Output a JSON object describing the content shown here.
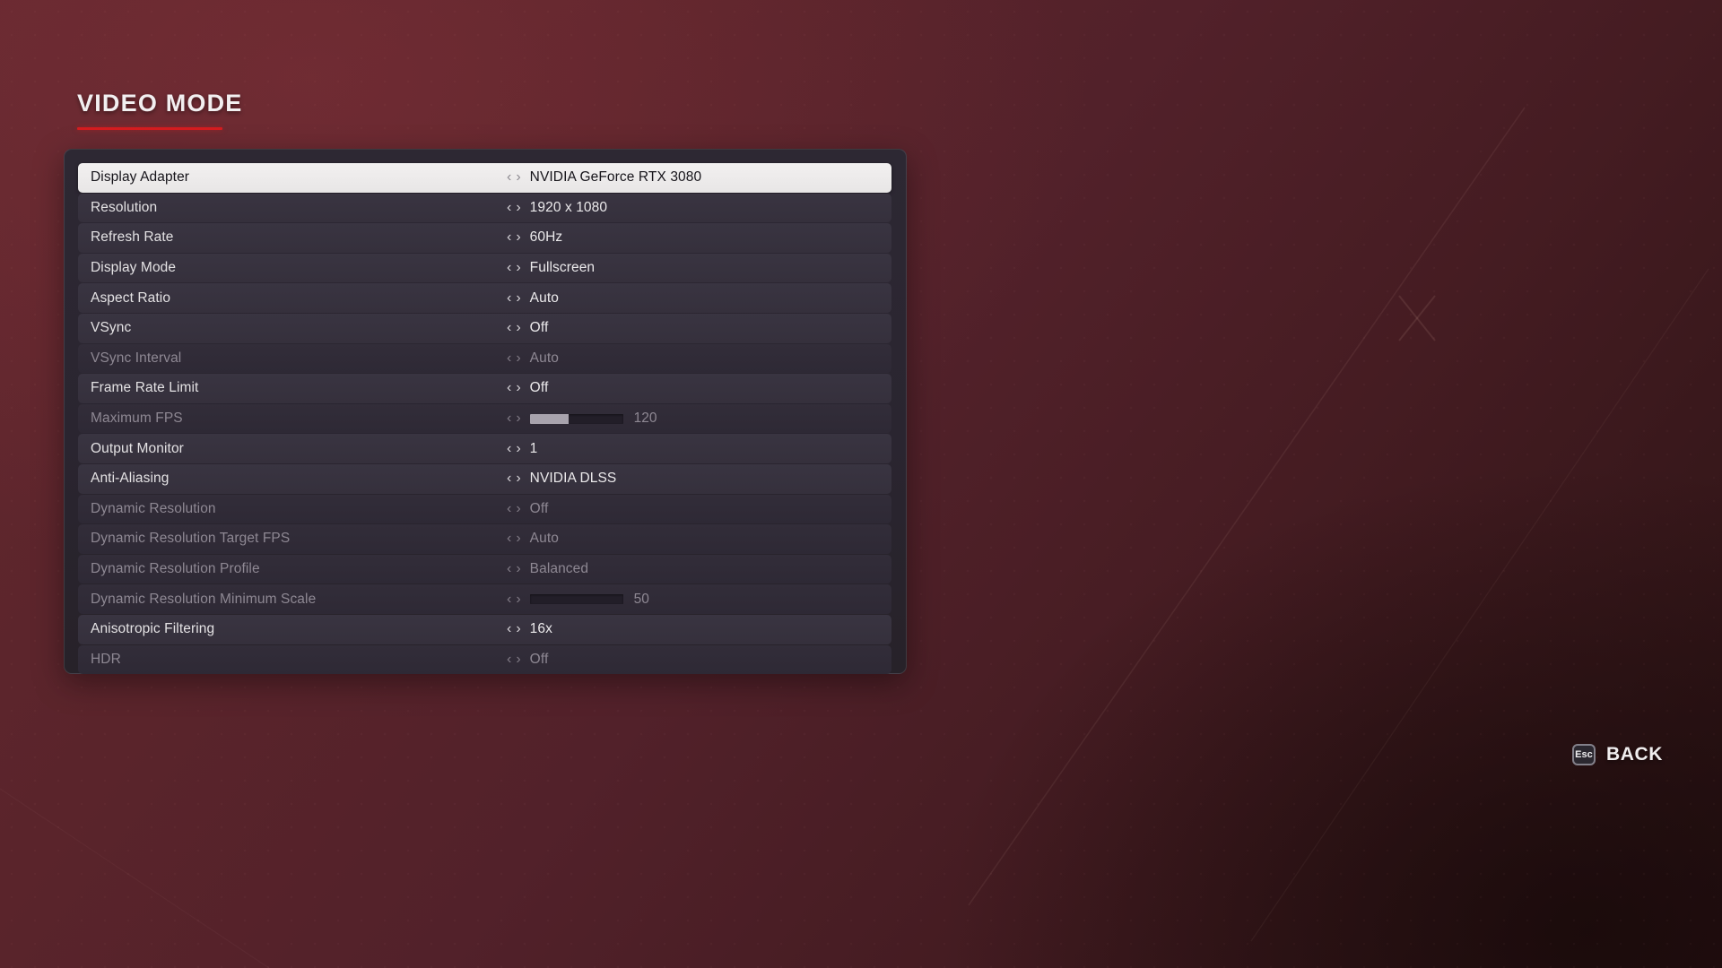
{
  "header": {
    "title": "VIDEO MODE",
    "accent_color": "#d51d20"
  },
  "background": {
    "top_color": "#63282f",
    "bottom_color": "#2b1214"
  },
  "settings": {
    "rows": [
      {
        "label": "Display Adapter",
        "value": "NVIDIA GeForce RTX 3080",
        "state": "selected",
        "type": "stepper"
      },
      {
        "label": "Resolution",
        "value": "1920 x 1080",
        "state": "enabled",
        "type": "stepper"
      },
      {
        "label": "Refresh Rate",
        "value": "60Hz",
        "state": "enabled",
        "type": "stepper"
      },
      {
        "label": "Display Mode",
        "value": "Fullscreen",
        "state": "enabled",
        "type": "stepper"
      },
      {
        "label": "Aspect Ratio",
        "value": "Auto",
        "state": "enabled",
        "type": "stepper"
      },
      {
        "label": "VSync",
        "value": "Off",
        "state": "enabled",
        "type": "stepper"
      },
      {
        "label": "VSync Interval",
        "value": "Auto",
        "state": "disabled",
        "type": "stepper"
      },
      {
        "label": "Frame Rate Limit",
        "value": "Off",
        "state": "enabled",
        "type": "stepper"
      },
      {
        "label": "Maximum FPS",
        "value": "120",
        "state": "disabled",
        "type": "slider",
        "fill_percent": 42
      },
      {
        "label": "Output Monitor",
        "value": "1",
        "state": "enabled",
        "type": "stepper"
      },
      {
        "label": "Anti-Aliasing",
        "value": "NVIDIA DLSS",
        "state": "enabled",
        "type": "stepper"
      },
      {
        "label": "Dynamic Resolution",
        "value": "Off",
        "state": "disabled",
        "type": "stepper"
      },
      {
        "label": "Dynamic Resolution Target FPS",
        "value": "Auto",
        "state": "disabled",
        "type": "stepper"
      },
      {
        "label": "Dynamic Resolution Profile",
        "value": "Balanced",
        "state": "disabled",
        "type": "stepper"
      },
      {
        "label": "Dynamic Resolution Minimum Scale",
        "value": "50",
        "state": "disabled",
        "type": "slider",
        "fill_percent": 0
      },
      {
        "label": "Anisotropic Filtering",
        "value": "16x",
        "state": "enabled",
        "type": "stepper"
      },
      {
        "label": "HDR",
        "value": "Off",
        "state": "disabled",
        "type": "stepper"
      }
    ],
    "arrow_left": "‹",
    "arrow_right": "›"
  },
  "footer": {
    "back_key": "Esc",
    "back_label": "BACK"
  }
}
